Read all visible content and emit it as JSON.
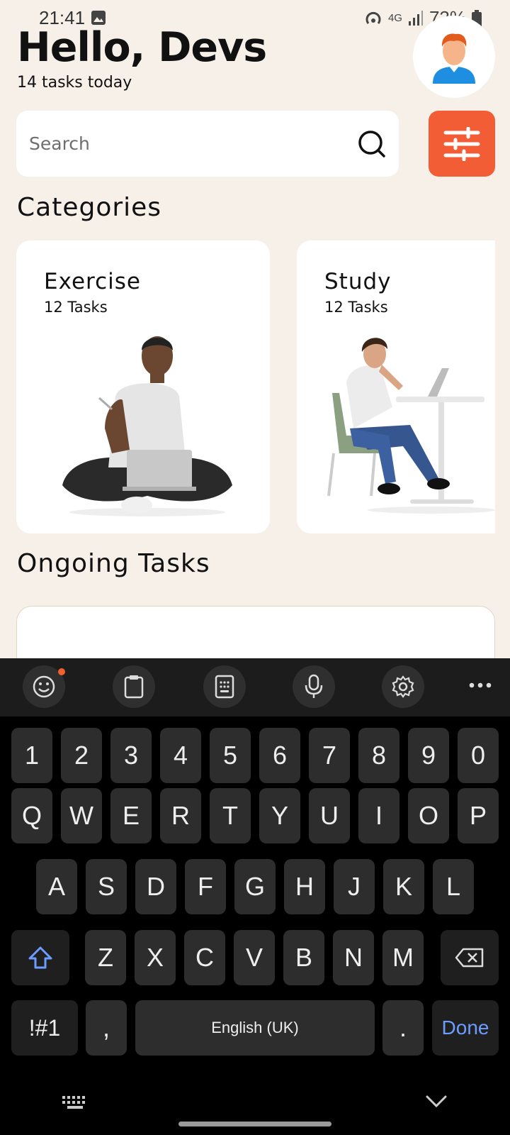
{
  "status_bar": {
    "time": "21:41",
    "network": "4G",
    "battery": "73%"
  },
  "header": {
    "greeting": "Hello, Devs",
    "subtitle": "14 tasks today"
  },
  "search": {
    "placeholder": "Search"
  },
  "categories": {
    "title": "Categories",
    "items": [
      {
        "title": "Exercise",
        "count": "12 Tasks"
      },
      {
        "title": "Study",
        "count": "12 Tasks"
      }
    ]
  },
  "ongoing": {
    "title": "Ongoing Tasks"
  },
  "keyboard": {
    "number_row": [
      "1",
      "2",
      "3",
      "4",
      "5",
      "6",
      "7",
      "8",
      "9",
      "0"
    ],
    "row1": [
      "Q",
      "W",
      "E",
      "R",
      "T",
      "Y",
      "U",
      "I",
      "O",
      "P"
    ],
    "row2": [
      "A",
      "S",
      "D",
      "F",
      "G",
      "H",
      "J",
      "K",
      "L"
    ],
    "row3": [
      "Z",
      "X",
      "C",
      "V",
      "B",
      "N",
      "M"
    ],
    "symbols": "!#1",
    "comma": ",",
    "space": "English (UK)",
    "period": ".",
    "done": "Done"
  },
  "colors": {
    "accent": "#f35d35",
    "background": "#f6f0e9",
    "done_text": "#6d9cff"
  }
}
